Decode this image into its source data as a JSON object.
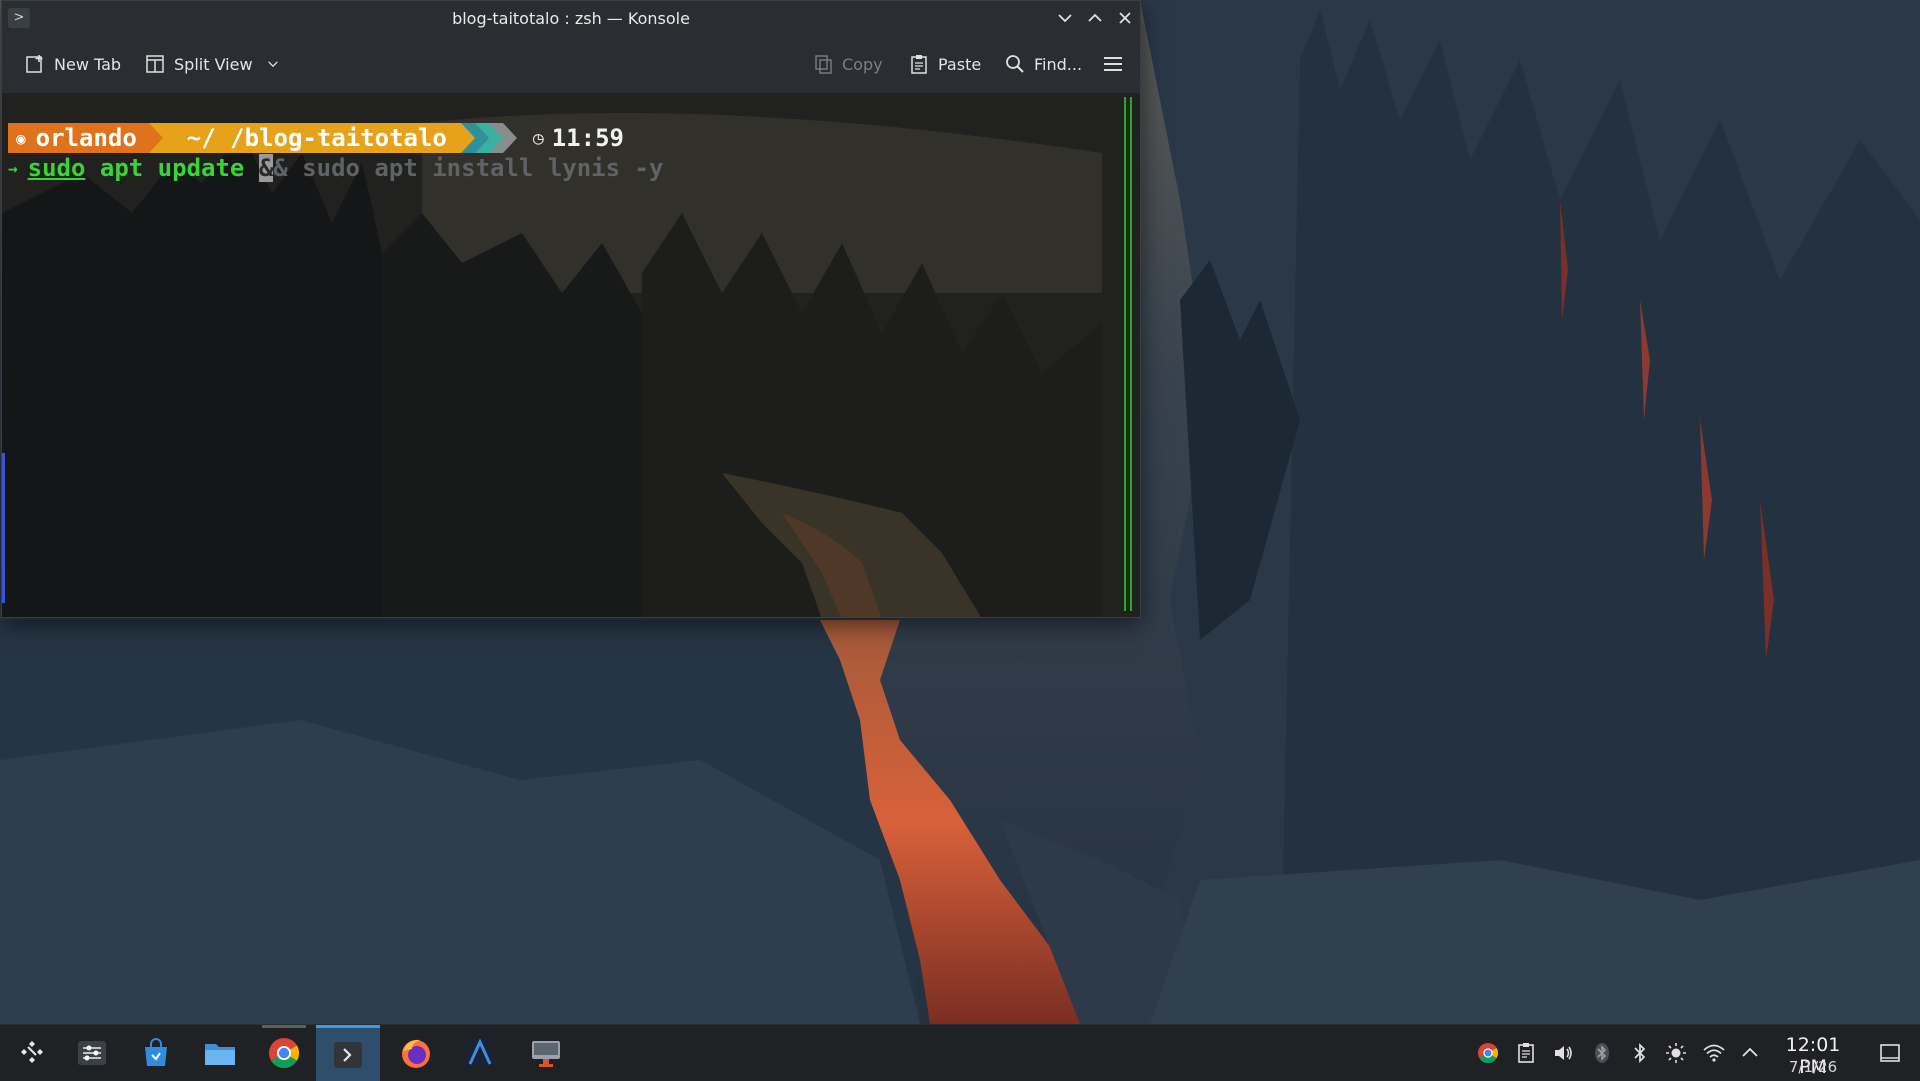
{
  "window": {
    "title": "blog-taitotalo : zsh — Konsole",
    "app_menu_glyph": ">"
  },
  "toolbar": {
    "new_tab_label": "New Tab",
    "split_view_label": "Split View",
    "copy_label": "Copy",
    "paste_label": "Paste",
    "find_label": "Find..."
  },
  "terminal": {
    "prompt_user": "orlando",
    "prompt_path": "~/ /blog-taitotalo",
    "prompt_time": "11:59",
    "cmd_arrow": "→",
    "cmd_sudo": "sudo",
    "cmd_apt_update": " apt update ",
    "cmd_cursor_char": "&",
    "cmd_suggestion": "& sudo apt install lynis -y",
    "colors": {
      "user_segment": "#e0721c",
      "path_segment": "#e6a21a",
      "command": "#38d438"
    }
  },
  "taskbar": {
    "items": [
      {
        "name": "app-launcher",
        "icon": "kde-launcher-icon"
      },
      {
        "name": "system-settings",
        "icon": "settings-sliders-icon"
      },
      {
        "name": "discover",
        "icon": "store-bag-icon"
      },
      {
        "name": "dolphin",
        "icon": "folder-icon"
      },
      {
        "name": "chrome",
        "icon": "chrome-icon"
      },
      {
        "name": "konsole",
        "icon": "terminal-icon",
        "active": true
      },
      {
        "name": "firefox",
        "icon": "firefox-icon"
      },
      {
        "name": "arch-app",
        "icon": "arch-a-icon"
      },
      {
        "name": "remote-desktop",
        "icon": "remote-monitor-icon"
      }
    ],
    "clock_time": "12:01 PM",
    "clock_date": "7/1/26"
  }
}
